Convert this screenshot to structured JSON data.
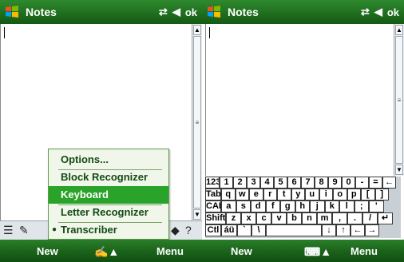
{
  "left": {
    "title": "Notes",
    "status_ok": "ok",
    "popup_items": [
      "Options...",
      "Block Recognizer",
      "Keyboard",
      "Letter Recognizer",
      "Transcriber"
    ],
    "softkey_left": "New",
    "softkey_right": "Menu"
  },
  "right": {
    "title": "Notes",
    "status_ok": "ok",
    "softkey_left": "New",
    "softkey_right": "Menu"
  },
  "keyboard": {
    "rows": [
      [
        "123",
        "1",
        "2",
        "3",
        "4",
        "5",
        "6",
        "7",
        "8",
        "9",
        "0",
        "-",
        "=",
        "←"
      ],
      [
        "Tab",
        "q",
        "w",
        "e",
        "r",
        "t",
        "y",
        "u",
        "i",
        "o",
        "p",
        "[",
        "]"
      ],
      [
        "CAP",
        "a",
        "s",
        "d",
        "f",
        "g",
        "h",
        "j",
        "k",
        "l",
        ";",
        "'"
      ],
      [
        "Shift",
        "z",
        "x",
        "c",
        "v",
        "b",
        "n",
        "m",
        ",",
        ".",
        "/",
        "↵"
      ],
      [
        "Ctl",
        "áü",
        "`",
        "\\",
        "",
        "↓",
        "↑",
        "←",
        "→"
      ]
    ]
  },
  "colors": {
    "titlebar_green": "#1f6f1f",
    "selection_green": "#2aa32a",
    "popup_bg": "#f0f7ea"
  },
  "icons": [
    "windows-logo-icon",
    "connectivity-icon",
    "speaker-icon",
    "input-panel-icon",
    "help-icon",
    "keyboard-icon"
  ]
}
